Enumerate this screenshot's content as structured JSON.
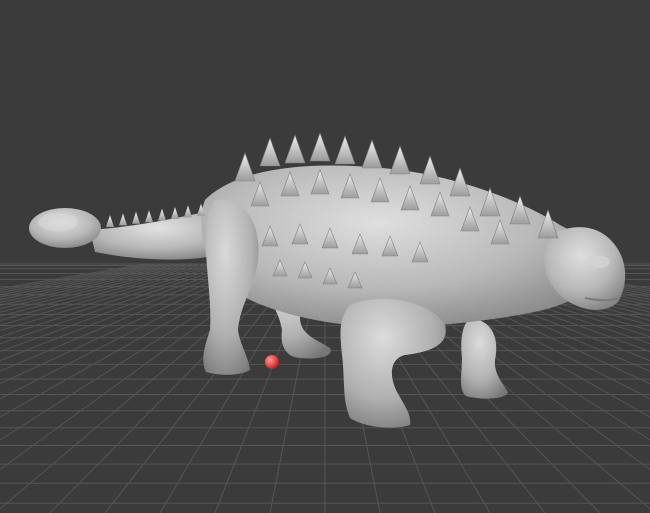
{
  "viewport": {
    "background": "#3b3b3b",
    "grid_color": "#555555",
    "model_color": "#bdbdbd",
    "model_shadow": "#6e6e6e",
    "model_highlight": "#e6e6e6",
    "pivot_marker_color": "#e84a4a"
  },
  "model": {
    "icon": "ankylosaurus-model"
  }
}
